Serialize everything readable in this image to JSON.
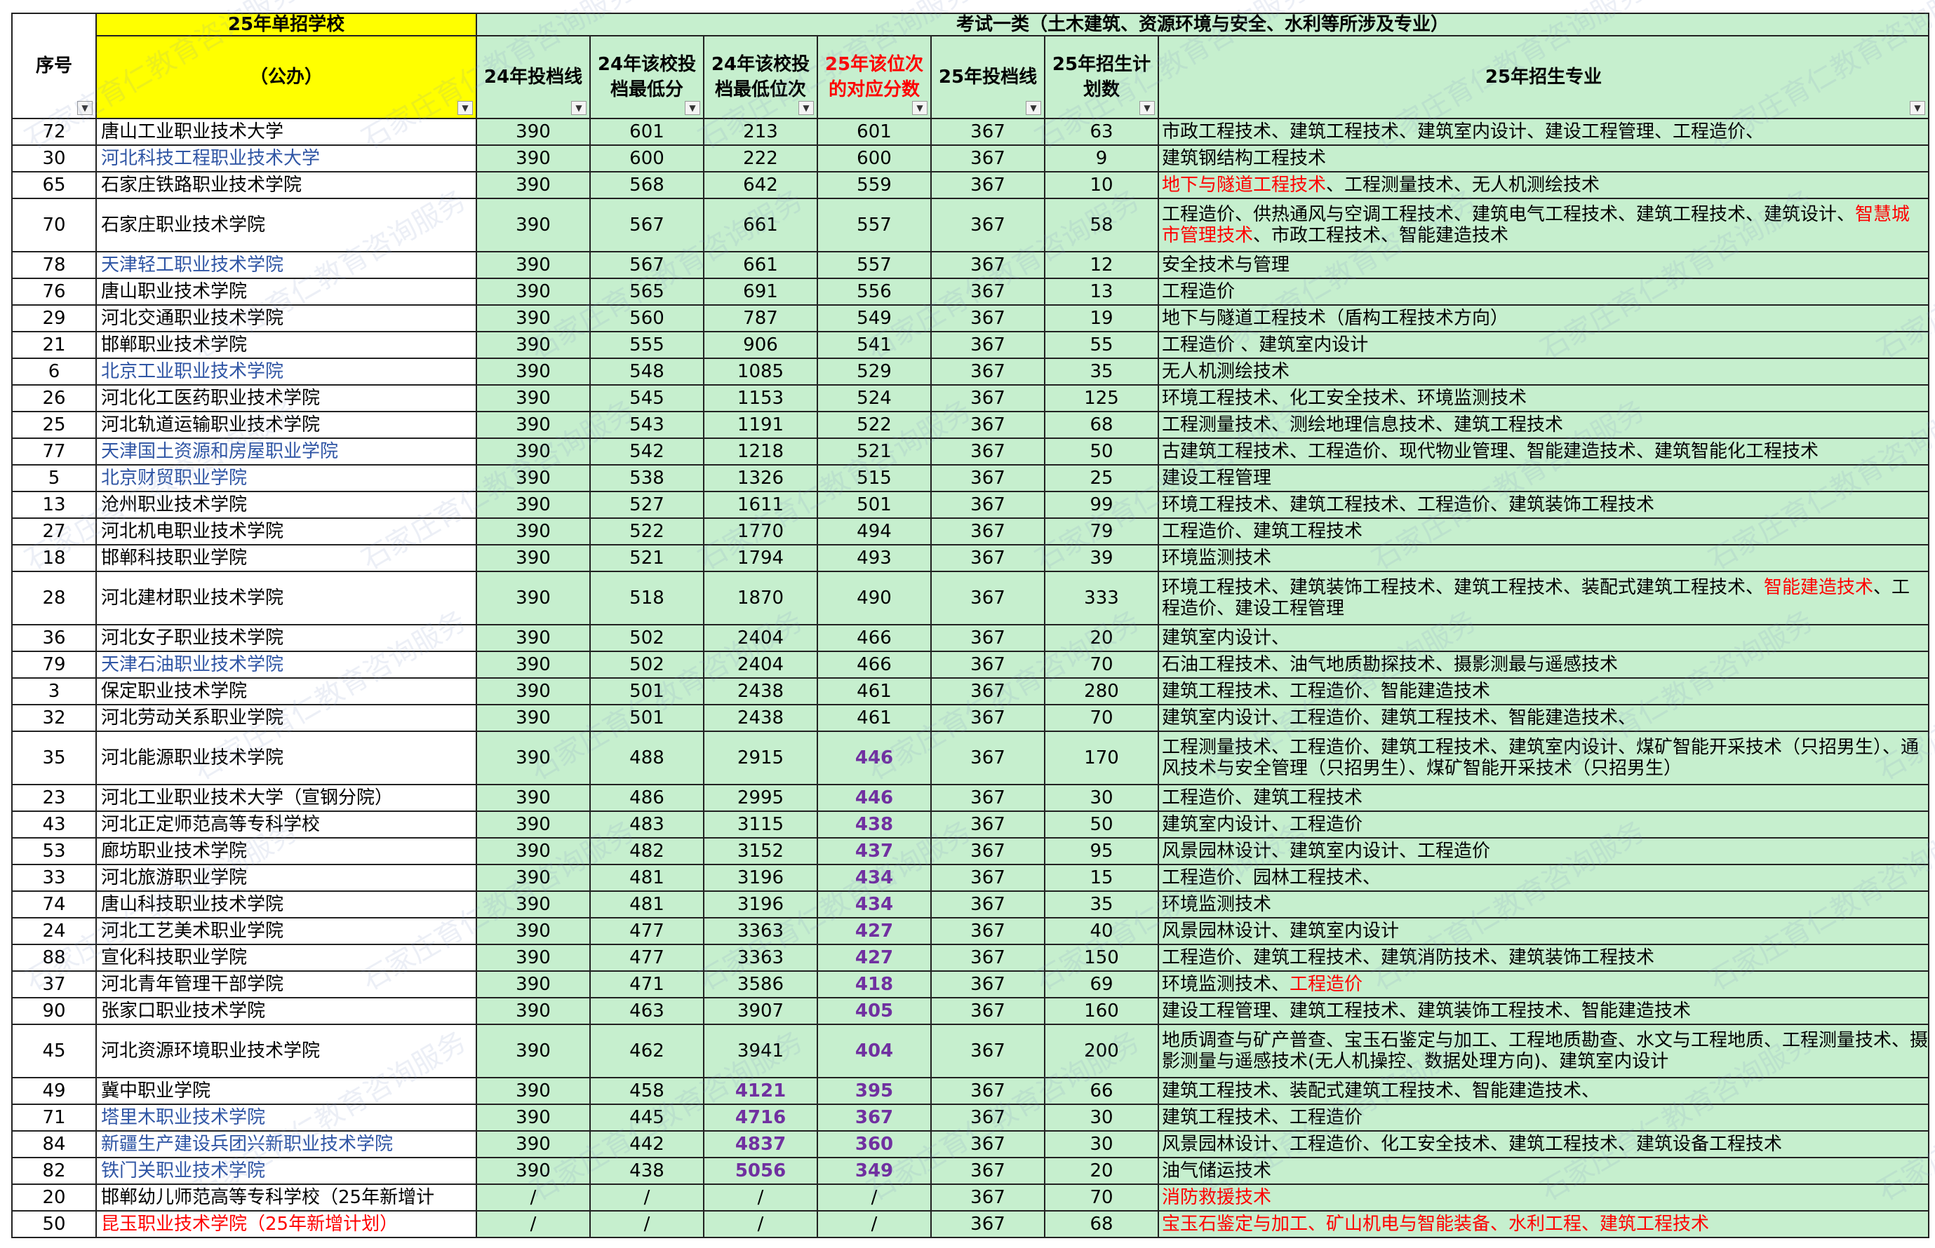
{
  "header": {
    "seq_label": "序号",
    "school_title": "25年单招学校",
    "school_sub": "（公办）",
    "group_title": "考试一类（土木建筑、资源环境与安全、水利等所涉及专业）",
    "col_24_line": "24年投档线",
    "col_24_min_score": "24年该校投档最低分",
    "col_24_min_rank": "24年该校投档最低位次",
    "col_25_rank_score": "25年该位次的对应分数",
    "col_25_line": "25年投档线",
    "col_25_plan": "25年招生计划数",
    "col_25_majors": "25年招生专业"
  },
  "watermark_text": "石家庄育仁教育咨询服务",
  "filter_icon": "▼",
  "rows": [
    {
      "seq": "72",
      "school": "唐山工业职业技术大学",
      "school_color": "black",
      "l24": "390",
      "min_score": "601",
      "min_rank": "213",
      "rank_score": "601",
      "l25": "367",
      "plan": "63",
      "majors": "市政工程技术、建筑工程技术、建筑室内设计、建设工程管理、工程造价、",
      "tall": false
    },
    {
      "seq": "30",
      "school": "河北科技工程职业技术大学",
      "school_color": "blue",
      "l24": "390",
      "min_score": "600",
      "min_rank": "222",
      "rank_score": "600",
      "l25": "367",
      "plan": "9",
      "majors": "建筑钢结构工程技术",
      "tall": false
    },
    {
      "seq": "65",
      "school": "石家庄铁路职业技术学院",
      "school_color": "black",
      "l24": "390",
      "min_score": "568",
      "min_rank": "642",
      "rank_score": "559",
      "l25": "367",
      "plan": "10",
      "majors_red": "地下与隧道工程技术",
      "majors": "、工程测量技术、无人机测绘技术",
      "tall": false
    },
    {
      "seq": "70",
      "school": "石家庄职业技术学院",
      "school_color": "black",
      "l24": "390",
      "min_score": "567",
      "min_rank": "661",
      "rank_score": "557",
      "l25": "367",
      "plan": "58",
      "majors": "工程造价、供热通风与空调工程技术、建筑电气工程技术、建筑工程技术、建筑设计、",
      "majors_red2": "智慧城市管理技术",
      "majors_tail": "、市政工程技术、智能建造技术",
      "tall": true
    },
    {
      "seq": "78",
      "school": "天津轻工职业技术学院",
      "school_color": "blue",
      "l24": "390",
      "min_score": "567",
      "min_rank": "661",
      "rank_score": "557",
      "l25": "367",
      "plan": "12",
      "majors": "安全技术与管理",
      "tall": false
    },
    {
      "seq": "76",
      "school": "唐山职业技术学院",
      "school_color": "black",
      "l24": "390",
      "min_score": "565",
      "min_rank": "691",
      "rank_score": "556",
      "l25": "367",
      "plan": "13",
      "majors": "工程造价",
      "tall": false
    },
    {
      "seq": "29",
      "school": "河北交通职业技术学院",
      "school_color": "black",
      "l24": "390",
      "min_score": "560",
      "min_rank": "787",
      "rank_score": "549",
      "l25": "367",
      "plan": "19",
      "majors": "地下与隧道工程技术（盾构工程技术方向）",
      "tall": false
    },
    {
      "seq": "21",
      "school": "邯郸职业技术学院",
      "school_color": "black",
      "l24": "390",
      "min_score": "555",
      "min_rank": "906",
      "rank_score": "541",
      "l25": "367",
      "plan": "55",
      "majors": "工程造价 、建筑室内设计",
      "tall": false
    },
    {
      "seq": "6",
      "school": "北京工业职业技术学院",
      "school_color": "blue",
      "l24": "390",
      "min_score": "548",
      "min_rank": "1085",
      "rank_score": "529",
      "l25": "367",
      "plan": "35",
      "majors": "无人机测绘技术",
      "tall": false
    },
    {
      "seq": "26",
      "school": "河北化工医药职业技术学院",
      "school_color": "black",
      "l24": "390",
      "min_score": "545",
      "min_rank": "1153",
      "rank_score": "524",
      "l25": "367",
      "plan": "125",
      "majors": "环境工程技术、化工安全技术、环境监测技术",
      "tall": false
    },
    {
      "seq": "25",
      "school": "河北轨道运输职业技术学院",
      "school_color": "black",
      "l24": "390",
      "min_score": "543",
      "min_rank": "1191",
      "rank_score": "522",
      "l25": "367",
      "plan": "68",
      "majors": "工程测量技术、测绘地理信息技术、建筑工程技术",
      "tall": false
    },
    {
      "seq": "77",
      "school": "天津国土资源和房屋职业学院",
      "school_color": "blue",
      "l24": "390",
      "min_score": "542",
      "min_rank": "1218",
      "rank_score": "521",
      "l25": "367",
      "plan": "50",
      "majors": "古建筑工程技术、工程造价、现代物业管理、智能建造技术、建筑智能化工程技术",
      "tall": false
    },
    {
      "seq": "5",
      "school": "北京财贸职业学院",
      "school_color": "blue",
      "l24": "390",
      "min_score": "538",
      "min_rank": "1326",
      "rank_score": "515",
      "l25": "367",
      "plan": "25",
      "majors": "建设工程管理",
      "tall": false
    },
    {
      "seq": "13",
      "school": "沧州职业技术学院",
      "school_color": "black",
      "l24": "390",
      "min_score": "527",
      "min_rank": "1611",
      "rank_score": "501",
      "l25": "367",
      "plan": "99",
      "majors": "环境工程技术、建筑工程技术、工程造价、建筑装饰工程技术",
      "tall": false
    },
    {
      "seq": "27",
      "school": "河北机电职业技术学院",
      "school_color": "black",
      "l24": "390",
      "min_score": "522",
      "min_rank": "1770",
      "rank_score": "494",
      "l25": "367",
      "plan": "79",
      "majors": "工程造价、建筑工程技术",
      "tall": false
    },
    {
      "seq": "18",
      "school": "邯郸科技职业学院",
      "school_color": "black",
      "l24": "390",
      "min_score": "521",
      "min_rank": "1794",
      "rank_score": "493",
      "l25": "367",
      "plan": "39",
      "majors": "环境监测技术",
      "tall": false
    },
    {
      "seq": "28",
      "school": "河北建材职业技术学院",
      "school_color": "black",
      "l24": "390",
      "min_score": "518",
      "min_rank": "1870",
      "rank_score": "490",
      "l25": "367",
      "plan": "333",
      "majors": "环境工程技术、建筑装饰工程技术、建筑工程技术、装配式建筑工程技术、",
      "majors_red2": "智能建造技术",
      "majors_tail": "、工程造价、建设工程管理",
      "tall": true
    },
    {
      "seq": "36",
      "school": "河北女子职业技术学院",
      "school_color": "black",
      "l24": "390",
      "min_score": "502",
      "min_rank": "2404",
      "rank_score": "466",
      "l25": "367",
      "plan": "20",
      "majors": "建筑室内设计、",
      "tall": false
    },
    {
      "seq": "79",
      "school": "天津石油职业技术学院",
      "school_color": "blue",
      "l24": "390",
      "min_score": "502",
      "min_rank": "2404",
      "rank_score": "466",
      "l25": "367",
      "plan": "70",
      "majors": "石油工程技术、油气地质勘探技术、摄影测最与遥感技术",
      "tall": false
    },
    {
      "seq": "3",
      "school": "保定职业技术学院",
      "school_color": "black",
      "l24": "390",
      "min_score": "501",
      "min_rank": "2438",
      "rank_score": "461",
      "l25": "367",
      "plan": "280",
      "majors": "建筑工程技术、工程造价、智能建造技术",
      "tall": false
    },
    {
      "seq": "32",
      "school": "河北劳动关系职业学院",
      "school_color": "black",
      "l24": "390",
      "min_score": "501",
      "min_rank": "2438",
      "rank_score": "461",
      "l25": "367",
      "plan": "70",
      "majors": "建筑室内设计、工程造价、建筑工程技术、智能建造技术、",
      "tall": false
    },
    {
      "seq": "35",
      "school": "河北能源职业技术学院",
      "school_color": "black",
      "l24": "390",
      "min_score": "488",
      "min_rank": "2915",
      "rank_score": "446",
      "rank_purple": true,
      "l25": "367",
      "plan": "170",
      "majors": "工程测量技术、工程造价、建筑工程技术、建筑室内设计、煤矿智能开采技术（只招男生）、通风技术与安全管理（只招男生）、煤矿智能开采技术（只招男生）",
      "tall": true
    },
    {
      "seq": "23",
      "school": "河北工业职业技术大学（宣钢分院）",
      "school_color": "black",
      "l24": "390",
      "min_score": "486",
      "min_rank": "2995",
      "rank_score": "446",
      "rank_purple": true,
      "l25": "367",
      "plan": "30",
      "majors": "工程造价、建筑工程技术",
      "tall": false
    },
    {
      "seq": "43",
      "school": "河北正定师范高等专科学校",
      "school_color": "black",
      "l24": "390",
      "min_score": "483",
      "min_rank": "3115",
      "rank_score": "438",
      "rank_purple": true,
      "l25": "367",
      "plan": "50",
      "majors": "建筑室内设计、工程造价",
      "tall": false
    },
    {
      "seq": "53",
      "school": "廊坊职业技术学院",
      "school_color": "black",
      "l24": "390",
      "min_score": "482",
      "min_rank": "3152",
      "rank_score": "437",
      "rank_purple": true,
      "l25": "367",
      "plan": "95",
      "majors": "风景园林设计、建筑室内设计、工程造价",
      "tall": false
    },
    {
      "seq": "33",
      "school": "河北旅游职业学院",
      "school_color": "black",
      "l24": "390",
      "min_score": "481",
      "min_rank": "3196",
      "rank_score": "434",
      "rank_purple": true,
      "l25": "367",
      "plan": "15",
      "majors": "工程造价、园林工程技术、",
      "tall": false
    },
    {
      "seq": "74",
      "school": "唐山科技职业技术学院",
      "school_color": "black",
      "l24": "390",
      "min_score": "481",
      "min_rank": "3196",
      "rank_score": "434",
      "rank_purple": true,
      "l25": "367",
      "plan": "35",
      "majors": "环境监测技术",
      "tall": false
    },
    {
      "seq": "24",
      "school": "河北工艺美术职业学院",
      "school_color": "black",
      "l24": "390",
      "min_score": "477",
      "min_rank": "3363",
      "rank_score": "427",
      "rank_purple": true,
      "l25": "367",
      "plan": "40",
      "majors": "风景园林设计、建筑室内设计",
      "tall": false
    },
    {
      "seq": "88",
      "school": "宣化科技职业学院",
      "school_color": "black",
      "l24": "390",
      "min_score": "477",
      "min_rank": "3363",
      "rank_score": "427",
      "rank_purple": true,
      "l25": "367",
      "plan": "150",
      "majors": "工程造价、建筑工程技术、建筑消防技术、建筑装饰工程技术",
      "tall": false
    },
    {
      "seq": "37",
      "school": "河北青年管理干部学院",
      "school_color": "black",
      "l24": "390",
      "min_score": "471",
      "min_rank": "3586",
      "rank_score": "418",
      "rank_purple": true,
      "l25": "367",
      "plan": "69",
      "majors": "环境监测技术、",
      "majors_red2": "工程造价",
      "majors_tail": "",
      "tall": false
    },
    {
      "seq": "90",
      "school": "张家口职业技术学院",
      "school_color": "black",
      "l24": "390",
      "min_score": "463",
      "min_rank": "3907",
      "rank_score": "405",
      "rank_purple": true,
      "l25": "367",
      "plan": "160",
      "majors": "建设工程管理、建筑工程技术、建筑装饰工程技术、智能建造技术",
      "tall": false
    },
    {
      "seq": "45",
      "school": "河北资源环境职业技术学院",
      "school_color": "black",
      "l24": "390",
      "min_score": "462",
      "min_rank": "3941",
      "rank_score": "404",
      "rank_purple": true,
      "l25": "367",
      "plan": "200",
      "majors": "地质调查与矿产普查、宝玉石鉴定与加工、工程地质勘查、水文与工程地质、工程测量技术、摄影测量与遥感技术(无人机操控、数据处理方向)、建筑室内设计",
      "tall": true
    },
    {
      "seq": "49",
      "school": "冀中职业学院",
      "school_color": "black",
      "l24": "390",
      "min_score": "458",
      "min_rank": "4121",
      "rank_purple2": true,
      "rank_score": "395",
      "rank_purple": true,
      "l25": "367",
      "plan": "66",
      "majors": "建筑工程技术、装配式建筑工程技术、智能建造技术、",
      "tall": false
    },
    {
      "seq": "71",
      "school": "塔里木职业技术学院",
      "school_color": "blue",
      "l24": "390",
      "min_score": "445",
      "min_rank": "4716",
      "rank_purple2": true,
      "rank_score": "367",
      "rank_purple": true,
      "l25": "367",
      "plan": "30",
      "majors": "建筑工程技术、工程造价",
      "tall": false
    },
    {
      "seq": "84",
      "school": "新疆生产建设兵团兴新职业技术学院",
      "school_color": "blue",
      "l24": "390",
      "min_score": "442",
      "min_rank": "4837",
      "rank_purple2": true,
      "rank_score": "360",
      "rank_purple": true,
      "l25": "367",
      "plan": "30",
      "majors": "风景园林设计、工程造价、化工安全技术、建筑工程技术、建筑设备工程技术",
      "tall": false
    },
    {
      "seq": "82",
      "school": "铁门关职业技术学院",
      "school_color": "blue",
      "l24": "390",
      "min_score": "438",
      "min_rank": "5056",
      "rank_purple2": true,
      "rank_score": "349",
      "rank_purple": true,
      "l25": "367",
      "plan": "20",
      "majors": "油气储运技术",
      "tall": false
    },
    {
      "seq": "20",
      "school": "邯郸幼儿师范高等专科学校（25年新增计",
      "school_color": "black",
      "l24": "/",
      "min_score": "/",
      "min_rank": "/",
      "rank_score": "/",
      "l25": "367",
      "plan": "70",
      "majors": "",
      "majors_red2": "消防救援技术",
      "majors_tail": "",
      "tall": false
    },
    {
      "seq": "50",
      "school": "昆玉职业技术学院（25年新增计划）",
      "school_color": "red",
      "l24": "/",
      "min_score": "/",
      "min_rank": "/",
      "rank_score": "/",
      "l25": "367",
      "plan": "68",
      "majors": "",
      "majors_red2": "宝玉石鉴定与加工、矿山机电与智能装备、水利工程、建筑工程技术",
      "majors_tail": "",
      "tall": false
    }
  ],
  "colors": {
    "header_yellow": "#ffff00",
    "green_fill": "#c6efce",
    "link_blue": "#2f55a4",
    "alert_red": "#ff0000",
    "purple": "#7030a0"
  }
}
